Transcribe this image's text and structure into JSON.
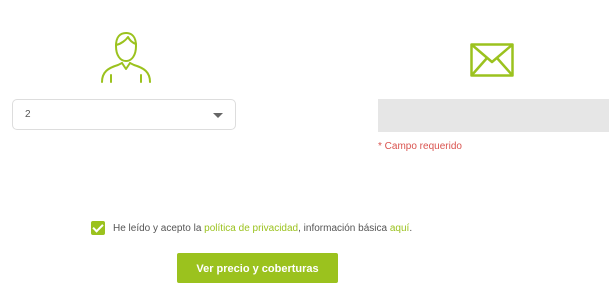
{
  "icons": {
    "person": "user-icon",
    "mail": "envelope-icon"
  },
  "form": {
    "select": {
      "value": "2"
    },
    "email": {
      "value": "",
      "error": "* Campo requerido"
    },
    "consent": {
      "checked": true,
      "prefix": "He leído y acepto la ",
      "privacy_link": "política de privacidad",
      "middle": ", información básica ",
      "info_link": "aquí",
      "suffix": "."
    },
    "submit_label": "Ver precio y coberturas"
  },
  "colors": {
    "accent": "#9bc21e",
    "error": "#d9534f",
    "input_bg": "#e6e6e6",
    "text": "#555555"
  }
}
